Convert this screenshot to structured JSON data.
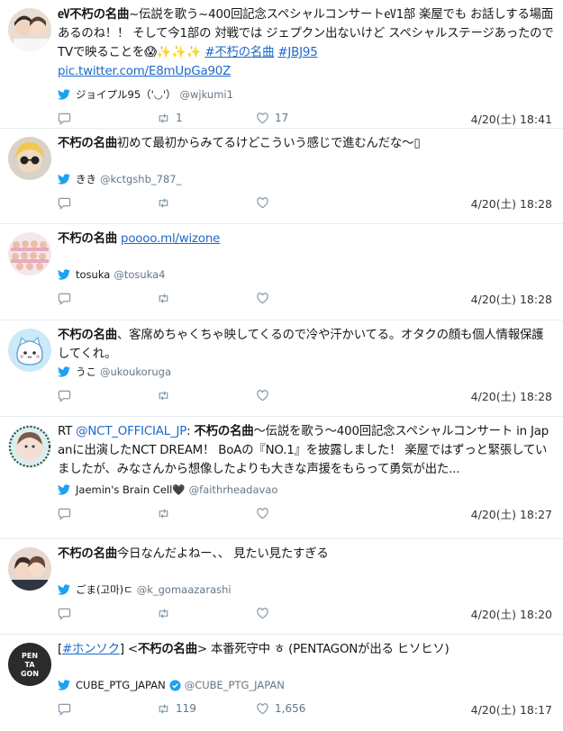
{
  "tweets": [
    {
      "segments": [
        "㋎不朽の名曲",
        "~伝説を歌う~400回記念スペシャルコンサート㋎1部 楽屋でも お話しする場面あるのね！！ そして今1部の 対戦では ジェプクン出ないけど スペシャルステージあったので TVで映ることを😱✨✨✨ ",
        "#不朽の名曲",
        " ",
        "#JBJ95",
        "\n",
        "pic.twitter.com/E8mUpGa90Z"
      ],
      "name": "ジョイプル95（'◡'）",
      "handle": "@wjkumi1",
      "retweets": "1",
      "likes": "17",
      "date": "4/20(土) 18:41"
    },
    {
      "segments": [
        "不朽の名曲",
        "初めて最初からみてるけどこういう感じで進むんだな〜▯"
      ],
      "name": "きき",
      "handle": "@kctgshb_787_",
      "date": "4/20(土) 18:28"
    },
    {
      "segments": [
        "不朽の名曲",
        " ",
        "poooo.ml/wizone"
      ],
      "name": "tosuka",
      "handle": "@tosuka4",
      "date": "4/20(土) 18:28"
    },
    {
      "segments": [
        "不朽の名曲",
        "、客席めちゃくちゃ映してくるので冷や汗かいてる。オタクの顔も個人情報保護してくれ。"
      ],
      "name": "うこ",
      "handle": "@ukoukoruga",
      "date": "4/20(土) 18:28"
    },
    {
      "segments": [
        "RT ",
        "@NCT_OFFICIAL_JP",
        ": ",
        "不朽の名曲",
        "〜伝説を歌う〜400回記念スペシャルコンサート in Japanに出演したNCT DREAM！ BoAの『NO.1』を披露しました！ 楽屋ではずっと緊張していましたが、みなさんから想像したよりも大きな声援をもらって勇気が出た..."
      ],
      "name": "Jaemin's Brain Cell🖤",
      "handle": "@faithrheadavao",
      "date": "4/20(土) 18:27"
    },
    {
      "segments": [
        "不朽の名曲",
        "今日なんだよねー、、 見たい見たすぎる"
      ],
      "name": "ごま(고마)ㄷ",
      "handle": "@k_gomaazarashi",
      "date": "4/20(土) 18:20"
    },
    {
      "segments": [
        "[",
        "#ホンソク",
        "] <",
        "不朽の名曲",
        "> 本番死守中 ㅎ (PENTAGONが出る ヒソヒソ)"
      ],
      "name": "CUBE_PTG_JAPAN",
      "handle": "@CUBE_PTG_JAPAN",
      "retweets": "119",
      "likes": "1,656",
      "date": "4/20(土) 18:17"
    }
  ],
  "avatars": {
    "pentagon_logo": "PEN TA GON"
  },
  "colors": {
    "link": "#1b6ac9",
    "meta": "#657786",
    "bird": "#1da1f2",
    "divider": "#e6ecf0"
  },
  "icons": [
    "twitter-bird-icon",
    "reply-icon",
    "retweet-icon",
    "like-icon",
    "verified-icon"
  ]
}
